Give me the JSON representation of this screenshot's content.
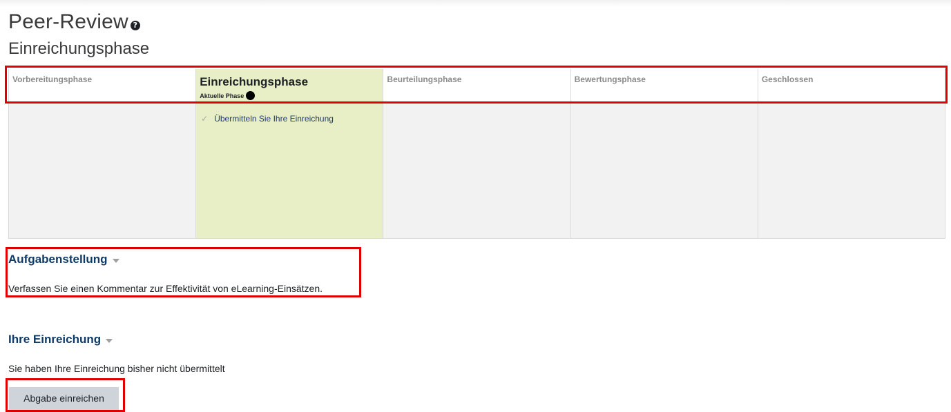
{
  "page": {
    "title": "Peer-Review",
    "phase_heading": "Einreichungsphase"
  },
  "phases": [
    {
      "name": "Vorbereitungsphase",
      "active": false
    },
    {
      "name": "Einreichungsphase",
      "active": true,
      "current_label": "Aktuelle Phase",
      "tasks": [
        {
          "label": "Übermitteln Sie Ihre Einreichung",
          "icon": "pending-checkmark-icon"
        }
      ]
    },
    {
      "name": "Beurteilungsphase",
      "active": false
    },
    {
      "name": "Bewertungsphase",
      "active": false
    },
    {
      "name": "Geschlossen",
      "active": false
    }
  ],
  "instructions": {
    "title": "Aufgabenstellung",
    "text": "Verfassen Sie einen Kommentar zur Effektivität von eLearning-Einsätzen."
  },
  "submission": {
    "title": "Ihre Einreichung",
    "status_text": "Sie haben Ihre Einreichung bisher nicht übermittelt",
    "button_label": "Abgabe einreichen"
  },
  "colors": {
    "active_phase_bg": "#e8efc7",
    "inactive_phase_bg": "#f2f2f2",
    "highlight_border": "#e00000",
    "section_title": "#0f3b66",
    "button_bg": "#ced4da"
  }
}
